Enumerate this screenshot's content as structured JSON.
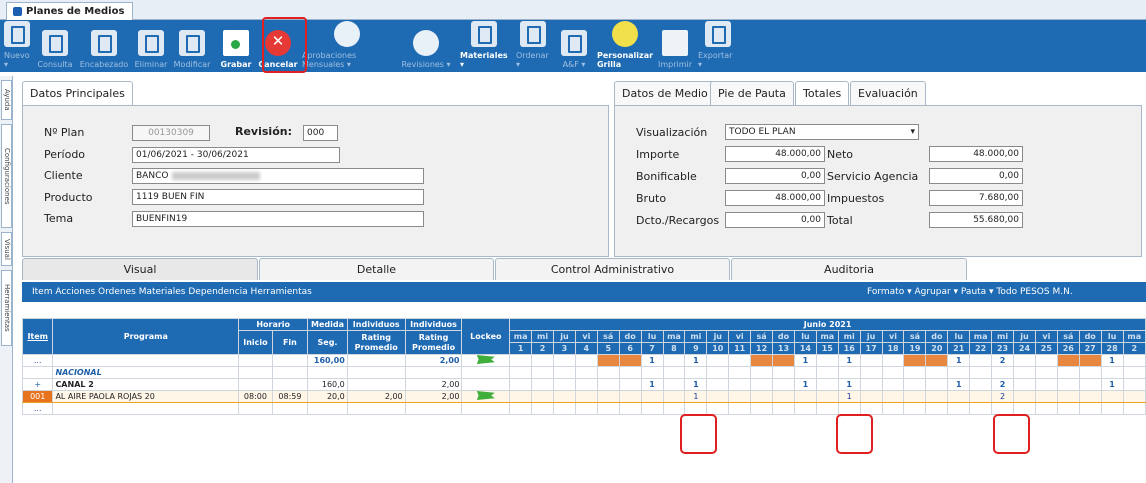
{
  "window": {
    "tab_title": "Planes de Medios"
  },
  "toolbar": {
    "buttons": [
      {
        "label": "Nuevo ▾",
        "icon": "new-doc-icon",
        "enabled": false
      },
      {
        "label": "Consulta",
        "icon": "query-icon",
        "enabled": false
      },
      {
        "label": "Encabezado",
        "icon": "header-icon",
        "enabled": false
      },
      {
        "label": "Eliminar",
        "icon": "delete-icon",
        "enabled": false
      },
      {
        "label": "Modificar",
        "icon": "edit-icon",
        "enabled": false
      },
      {
        "label": "Grabar",
        "icon": "save-icon",
        "enabled": true
      },
      {
        "label": "Cancelar",
        "icon": "cancel-icon",
        "enabled": true
      },
      {
        "label": "Aprobaciones Mensuales ▾",
        "icon": "approvals-icon",
        "enabled": false
      },
      {
        "label": "Revisiones ▾",
        "icon": "revisions-icon",
        "enabled": false
      },
      {
        "label": "Materiales ▾",
        "icon": "materials-icon",
        "enabled": true
      },
      {
        "label": "Ordenar ▾",
        "icon": "sort-icon",
        "enabled": false
      },
      {
        "label": "A&F ▾",
        "icon": "af-icon",
        "enabled": false
      },
      {
        "label": "Personalizar Grilla",
        "icon": "grid-custom-icon",
        "enabled": true
      },
      {
        "label": "Imprimir",
        "icon": "print-icon",
        "enabled": false
      },
      {
        "label": "Exportar ▾",
        "icon": "export-icon",
        "enabled": false
      }
    ]
  },
  "side_tabs": [
    "Ayuda",
    "Configuraciones",
    "Visual",
    "Herramientas"
  ],
  "datos_principales": {
    "tab": "Datos Principales",
    "nro_plan_label": "Nº Plan",
    "nro_plan": "00130309",
    "revision_label": "Revisión:",
    "revision": "000",
    "periodo_label": "Período",
    "periodo": "01/06/2021 - 30/06/2021",
    "cliente_label": "Cliente",
    "cliente": "BANCO",
    "producto_label": "Producto",
    "producto": "1119 BUEN FIN",
    "tema_label": "Tema",
    "tema": "BUENFIN19"
  },
  "totales": {
    "tabs": [
      "Datos de Medio",
      "Pie de Pauta",
      "Totales",
      "Evaluación"
    ],
    "active_tab": "Totales",
    "visualizacion_label": "Visualización",
    "visualizacion": "TODO EL PLAN",
    "importe_label": "Importe",
    "importe": "48.000,00",
    "neto_label": "Neto",
    "neto": "48.000,00",
    "bonificable_label": "Bonificable",
    "bonificable": "0,00",
    "servicio_label": "Servicio Agencia",
    "servicio": "0,00",
    "bruto_label": "Bruto",
    "bruto": "48.000,00",
    "impuestos_label": "Impuestos",
    "impuestos": "7.680,00",
    "dcto_label": "Dcto./Recargos",
    "dcto": "0,00",
    "total_label": "Total",
    "total": "55.680,00"
  },
  "bottom_tabs": [
    "Visual",
    "Detalle",
    "Control Administrativo",
    "Auditoria"
  ],
  "menubar": {
    "left": "Item  Acciones  Ordenes  Materiales  Dependencia  Herramientas",
    "right": "Formato ▾   Agrupar ▾   Pauta ▾   Todo   PESOS M.N."
  },
  "grid": {
    "headers": {
      "item": "Item",
      "programa": "Programa",
      "horario": "Horario",
      "inicio": "Inicio",
      "fin": "Fin",
      "medida": "Medida",
      "seg": "Seg.",
      "ind1": "Individuos",
      "rating1": "Rating Promedio",
      "ind2": "Individuos",
      "rating2": "Rating Promedio",
      "lockeo": "Lockeo",
      "month": "Junio 2021"
    },
    "days": [
      "ma",
      "mi",
      "ju",
      "vi",
      "sá",
      "do",
      "lu",
      "ma",
      "mi",
      "ju",
      "vi",
      "sá",
      "do",
      "lu",
      "ma",
      "mi",
      "ju",
      "vi",
      "sá",
      "do",
      "lu",
      "ma",
      "mi",
      "ju",
      "vi",
      "sá",
      "do",
      "lu",
      "ma"
    ],
    "dates": [
      "1",
      "2",
      "3",
      "4",
      "5",
      "6",
      "7",
      "8",
      "9",
      "10",
      "11",
      "12",
      "13",
      "14",
      "15",
      "16",
      "17",
      "18",
      "19",
      "20",
      "21",
      "22",
      "23",
      "24",
      "25",
      "26",
      "27",
      "28",
      "2"
    ],
    "row_total": {
      "item": "...",
      "seg": "160,00",
      "rating2": "2,00"
    },
    "row_nacional": {
      "programa": "NACIONAL"
    },
    "row_canal": {
      "item": "+",
      "programa": "CANAL 2",
      "seg": "160,0",
      "rating2": "2,00"
    },
    "row_detail": {
      "item": "001",
      "programa": "AL AIRE PAOLA ROJAS 20",
      "inicio": "08:00",
      "fin": "08:59",
      "seg": "20,0",
      "rating1": "2,00",
      "rating2": "2,00"
    },
    "row_empty": {
      "item": "..."
    },
    "spot_values": {
      "total": {
        "7": "1",
        "9": "1",
        "14": "1",
        "16": "1",
        "21": "1",
        "23": "2",
        "28": "1"
      },
      "canal": {
        "7": "1",
        "9": "1",
        "14": "1",
        "16": "1",
        "21": "1",
        "23": "2",
        "28": "1"
      },
      "detail": {
        "9": "1",
        "16": "1",
        "23": "2"
      }
    }
  }
}
